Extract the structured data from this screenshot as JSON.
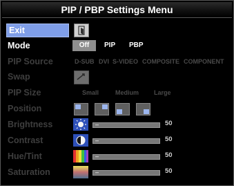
{
  "title": "PIP / PBP Settings Menu",
  "rows": {
    "exit": "Exit",
    "mode": {
      "label": "Mode",
      "options": [
        "Off",
        "PIP",
        "PBP"
      ],
      "selected": "Off"
    },
    "pip_source": {
      "label": "PIP Source",
      "options": [
        "D-SUB",
        "DVI",
        "S-VIDEO",
        "COMPOSITE",
        "COMPONENT"
      ]
    },
    "swap": {
      "label": "Swap"
    },
    "pip_size": {
      "label": "PIP Size",
      "options": [
        "Small",
        "Medium",
        "Large"
      ]
    },
    "position": {
      "label": "Position"
    },
    "brightness": {
      "label": "Brightness",
      "value": "50"
    },
    "contrast": {
      "label": "Contrast",
      "value": "50"
    },
    "hue_tint": {
      "label": "Hue/Tint",
      "value": "50"
    },
    "saturation": {
      "label": "Saturation",
      "value": "50"
    }
  },
  "slider_min_mark": "–",
  "colors": {
    "selected_bg": "#7f9ee8",
    "off_button": "#8e8e8e",
    "dim_text": "#3e3e3e"
  }
}
